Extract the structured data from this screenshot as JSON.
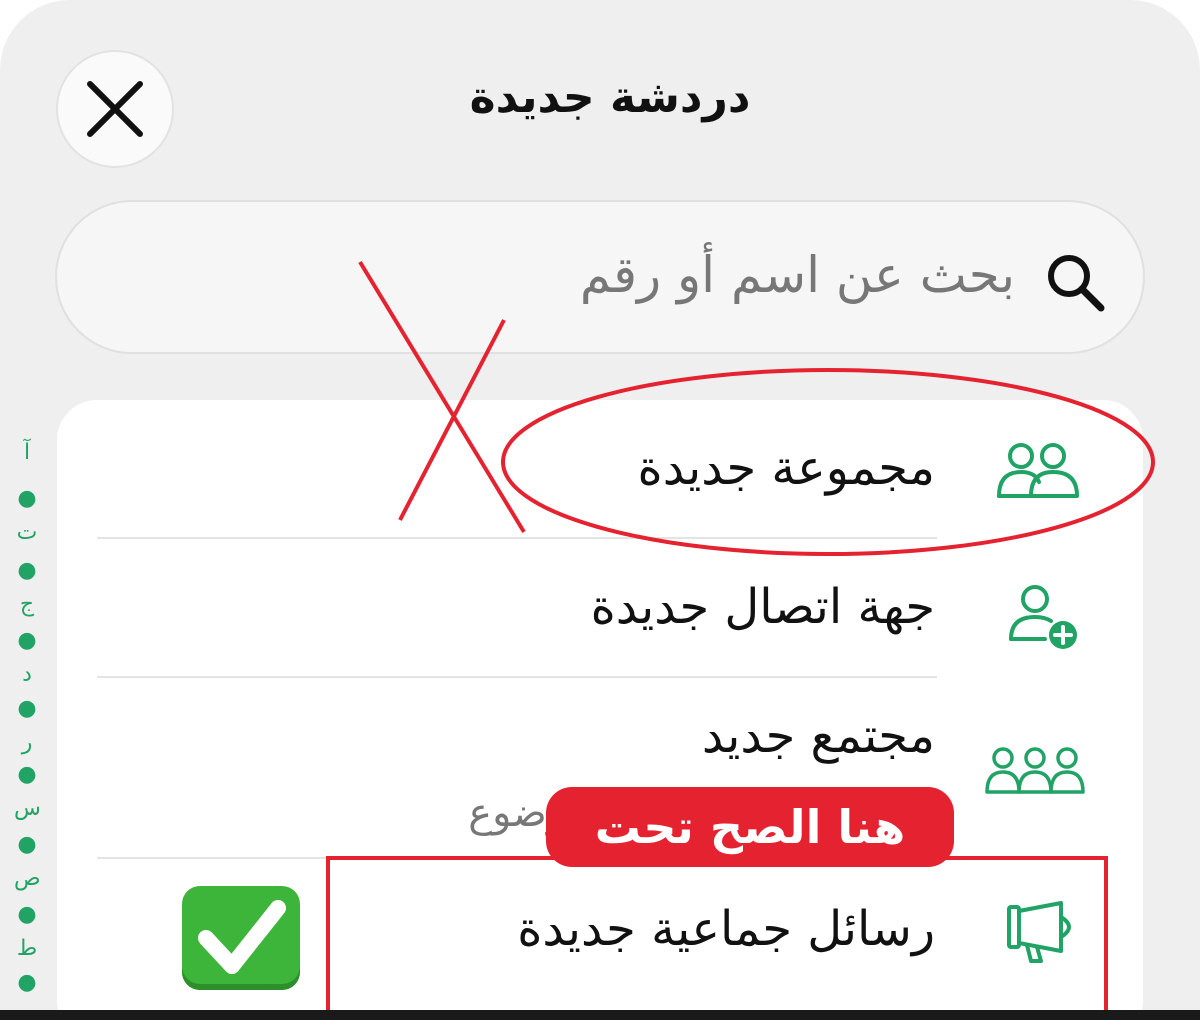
{
  "header": {
    "title": "دردشة جديدة"
  },
  "search": {
    "placeholder": "بحث عن اسم أو رقم"
  },
  "menu": {
    "items": [
      {
        "label": "مجموعة جديدة"
      },
      {
        "label": "جهة اتصال جديدة"
      },
      {
        "label": "مجتمع جديد",
        "subtitle": "ات محددة الموضوع"
      },
      {
        "label": "رسائل جماعية جديدة"
      }
    ]
  },
  "index_letters": [
    "آ",
    "ت",
    "ج",
    "د",
    "ر",
    "س",
    "ص",
    "ط"
  ],
  "annotation": {
    "badge_text": "هنا الصح تحت"
  },
  "colors": {
    "accent_green": "#21a366",
    "annotation_red": "#e5222f",
    "sheet_bg": "#efefef"
  }
}
